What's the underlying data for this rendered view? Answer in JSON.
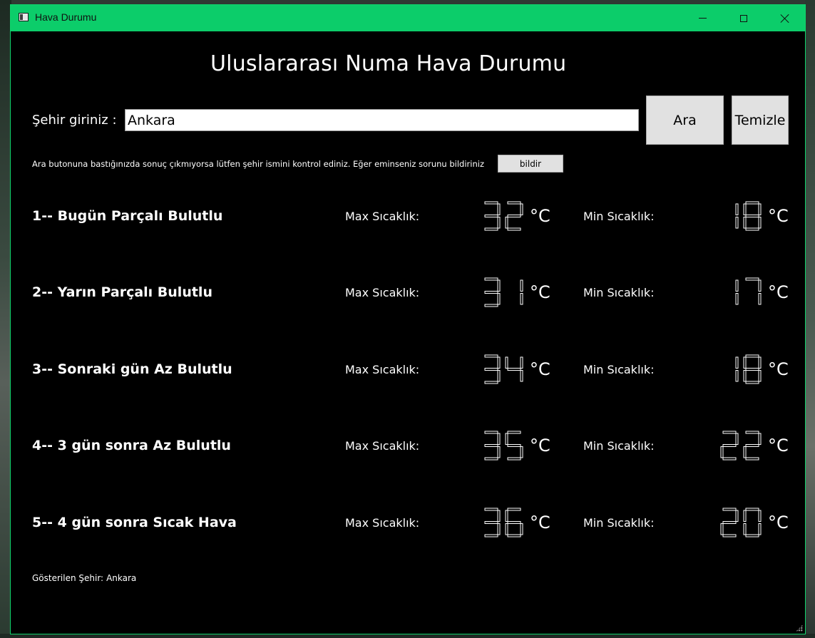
{
  "window": {
    "title": "Hava Durumu",
    "accent_color": "#0ccd6a",
    "background_color": "#000000"
  },
  "heading": "Uluslararası Numa Hava Durumu",
  "search": {
    "label": "Şehir giriniz :",
    "value": "Ankara",
    "search_button": "Ara",
    "clear_button": "Temizle"
  },
  "hint": {
    "text": "Ara butonuna bastığınızda sonuç çıkmıyorsa lütfen şehir ismini kontrol ediniz. Eğer eminseniz sorunu bildiriniz",
    "report_button": "bildir"
  },
  "forecast": [
    {
      "day": "1-- Bugün Parçalı Bulutlu",
      "max_label": "Max Sıcaklık:",
      "max": "32",
      "min_label": "Min Sıcaklık:",
      "min": "18",
      "unit": "°C"
    },
    {
      "day": "2-- Yarın Parçalı Bulutlu",
      "max_label": "Max Sıcaklık:",
      "max": "31",
      "min_label": "Min Sıcaklık:",
      "min": "17",
      "unit": "°C"
    },
    {
      "day": "3-- Sonraki gün Az Bulutlu",
      "max_label": "Max Sıcaklık:",
      "max": "34",
      "min_label": "Min Sıcaklık:",
      "min": "18",
      "unit": "°C"
    },
    {
      "day": "4-- 3 gün sonra Az Bulutlu",
      "max_label": "Max Sıcaklık:",
      "max": "35",
      "min_label": "Min Sıcaklık:",
      "min": "22",
      "unit": "°C"
    },
    {
      "day": "5-- 4 gün sonra Sıcak Hava",
      "max_label": "Max Sıcaklık:",
      "max": "36",
      "min_label": "Min Sıcaklık:",
      "min": "20",
      "unit": "°C"
    }
  ],
  "footer": {
    "shown_city_label": "Gösterilen Şehir:",
    "shown_city": "Ankara"
  },
  "icons": {
    "app": "window-app-icon",
    "minimize": "minimize-icon",
    "maximize": "maximize-icon",
    "close": "close-icon",
    "resize": "resize-grip-icon"
  }
}
